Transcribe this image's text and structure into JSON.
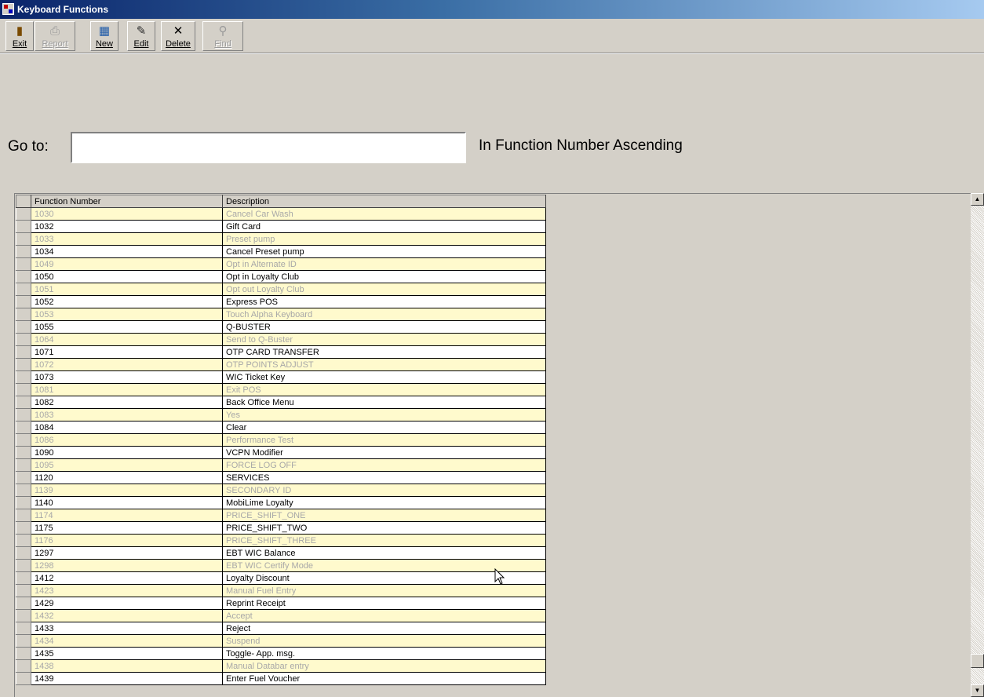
{
  "window": {
    "title": "Keyboard Functions"
  },
  "toolbar": {
    "buttons": [
      {
        "label": "Exit",
        "icon": "exit-door-icon"
      },
      {
        "label": "Report",
        "icon": "printer-icon"
      },
      {
        "label": "New",
        "icon": "new-record-icon"
      },
      {
        "label": "Edit",
        "icon": "edit-record-icon"
      },
      {
        "label": "Delete",
        "icon": "delete-x-icon"
      },
      {
        "label": "Find",
        "icon": "binoculars-icon"
      }
    ]
  },
  "goto": {
    "label": "Go to:",
    "value": "",
    "order_text": "In Function Number Ascending"
  },
  "grid": {
    "columns": [
      "Function Number",
      "Description"
    ],
    "rows": [
      [
        "1030",
        "Cancel Car Wash"
      ],
      [
        "1032",
        "Gift Card"
      ],
      [
        "1033",
        "Preset pump"
      ],
      [
        "1034",
        "Cancel Preset pump"
      ],
      [
        "1049",
        "Opt in Alternate ID"
      ],
      [
        "1050",
        "Opt in Loyalty Club"
      ],
      [
        "1051",
        "Opt out Loyalty Club"
      ],
      [
        "1052",
        "Express POS"
      ],
      [
        "1053",
        "Touch Alpha Keyboard"
      ],
      [
        "1055",
        "Q-BUSTER"
      ],
      [
        "1064",
        "Send to Q-Buster"
      ],
      [
        "1071",
        "OTP CARD TRANSFER"
      ],
      [
        "1072",
        "OTP POINTS ADJUST"
      ],
      [
        "1073",
        "WIC Ticket Key"
      ],
      [
        "1081",
        "Exit POS"
      ],
      [
        "1082",
        "Back Office Menu"
      ],
      [
        "1083",
        "Yes"
      ],
      [
        "1084",
        "Clear"
      ],
      [
        "1086",
        "Performance Test"
      ],
      [
        "1090",
        "VCPN Modifier"
      ],
      [
        "1095",
        "FORCE LOG OFF"
      ],
      [
        "1120",
        "SERVICES"
      ],
      [
        "1139",
        "SECONDARY ID"
      ],
      [
        "1140",
        "MobiLime Loyalty"
      ],
      [
        "1174",
        "PRICE_SHIFT_ONE"
      ],
      [
        "1175",
        "PRICE_SHIFT_TWO"
      ],
      [
        "1176",
        "PRICE_SHIFT_THREE"
      ],
      [
        "1297",
        "EBT WIC Balance"
      ],
      [
        "1298",
        "EBT WIC Certify Mode"
      ],
      [
        "1412",
        "Loyalty Discount"
      ],
      [
        "1423",
        "Manual Fuel Entry"
      ],
      [
        "1429",
        "Reprint Receipt"
      ],
      [
        "1432",
        "Accept"
      ],
      [
        "1433",
        "Reject"
      ],
      [
        "1434",
        "Suspend"
      ],
      [
        "1435",
        "Toggle- App. msg."
      ],
      [
        "1438",
        "Manual Databar entry"
      ],
      [
        "1439",
        "Enter Fuel Voucher"
      ]
    ]
  }
}
